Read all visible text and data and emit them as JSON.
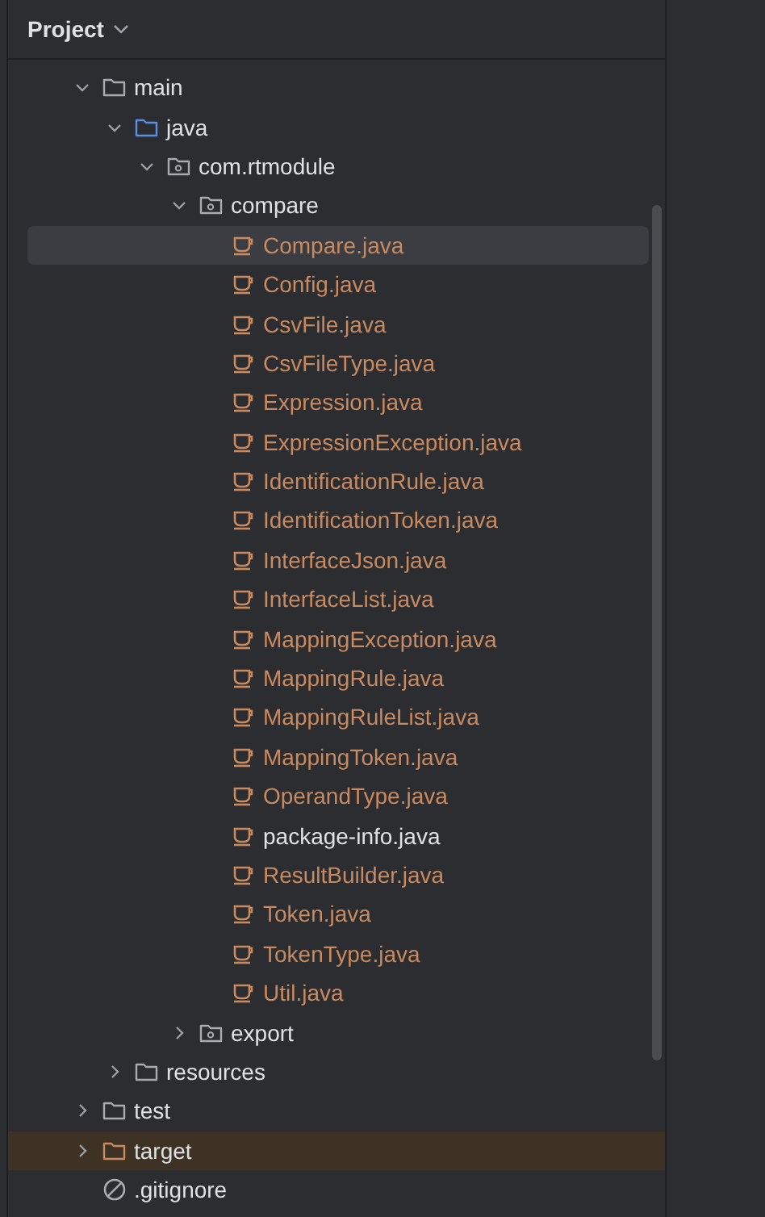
{
  "panel": {
    "title": "Project"
  },
  "tree": [
    {
      "label": "main",
      "kind": "folder",
      "expanded": true,
      "selected": false,
      "children": [
        {
          "label": "java",
          "kind": "source-folder",
          "expanded": true,
          "selected": false,
          "children": [
            {
              "label": "com.rtmodule",
              "kind": "package",
              "expanded": true,
              "selected": false,
              "children": [
                {
                  "label": "compare",
                  "kind": "package",
                  "expanded": true,
                  "selected": false,
                  "children": [
                    {
                      "label": "Compare.java",
                      "kind": "file",
                      "color": "#c98a5f",
                      "selected": true
                    },
                    {
                      "label": "Config.java",
                      "kind": "file",
                      "color": "#c98a5f",
                      "selected": false
                    },
                    {
                      "label": "CsvFile.java",
                      "kind": "file",
                      "color": "#c98a5f",
                      "selected": false
                    },
                    {
                      "label": "CsvFileType.java",
                      "kind": "file",
                      "color": "#c98a5f",
                      "selected": false
                    },
                    {
                      "label": "Expression.java",
                      "kind": "file",
                      "color": "#c98a5f",
                      "selected": false
                    },
                    {
                      "label": "ExpressionException.java",
                      "kind": "file",
                      "color": "#c98a5f",
                      "selected": false
                    },
                    {
                      "label": "IdentificationRule.java",
                      "kind": "file",
                      "color": "#c98a5f",
                      "selected": false
                    },
                    {
                      "label": "IdentificationToken.java",
                      "kind": "file",
                      "color": "#c98a5f",
                      "selected": false
                    },
                    {
                      "label": "InterfaceJson.java",
                      "kind": "file",
                      "color": "#c98a5f",
                      "selected": false
                    },
                    {
                      "label": "InterfaceList.java",
                      "kind": "file",
                      "color": "#c98a5f",
                      "selected": false
                    },
                    {
                      "label": "MappingException.java",
                      "kind": "file",
                      "color": "#c98a5f",
                      "selected": false
                    },
                    {
                      "label": "MappingRule.java",
                      "kind": "file",
                      "color": "#c98a5f",
                      "selected": false
                    },
                    {
                      "label": "MappingRuleList.java",
                      "kind": "file",
                      "color": "#c98a5f",
                      "selected": false
                    },
                    {
                      "label": "MappingToken.java",
                      "kind": "file",
                      "color": "#c98a5f",
                      "selected": false
                    },
                    {
                      "label": "OperandType.java",
                      "kind": "file",
                      "color": "#c98a5f",
                      "selected": false
                    },
                    {
                      "label": "package-info.java",
                      "kind": "file",
                      "color": "#dfe1e5",
                      "selected": false
                    },
                    {
                      "label": "ResultBuilder.java",
                      "kind": "file",
                      "color": "#c98a5f",
                      "selected": false
                    },
                    {
                      "label": "Token.java",
                      "kind": "file",
                      "color": "#c98a5f",
                      "selected": false
                    },
                    {
                      "label": "TokenType.java",
                      "kind": "file",
                      "color": "#c98a5f",
                      "selected": false
                    },
                    {
                      "label": "Util.java",
                      "kind": "file",
                      "color": "#c98a5f",
                      "selected": false
                    }
                  ]
                },
                {
                  "label": "export",
                  "kind": "package",
                  "expanded": false,
                  "selected": false
                }
              ]
            }
          ]
        },
        {
          "label": "resources",
          "kind": "folder",
          "expanded": false,
          "selected": false
        }
      ]
    },
    {
      "label": "test",
      "kind": "folder",
      "expanded": false,
      "selected": false
    },
    {
      "label": "target",
      "kind": "excluded-folder",
      "expanded": false,
      "selected": false
    },
    {
      "label": ".gitignore",
      "kind": "ignore-file",
      "selected": false
    }
  ]
}
